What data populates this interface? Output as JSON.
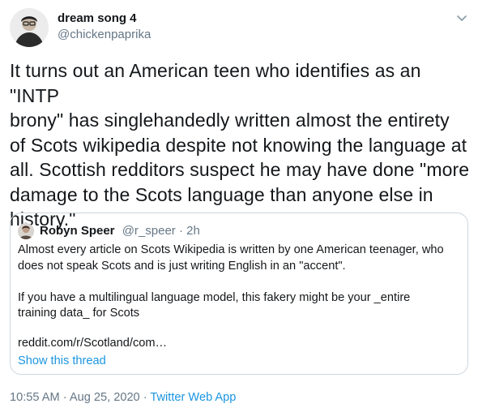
{
  "author": {
    "display_name": "dream song 4",
    "handle": "@chickenpaprika"
  },
  "tweet": {
    "text": "It turns out an American teen who identifies as an \"INTP\nbrony\" has singlehandedly written almost the entirety\nof Scots wikipedia despite not knowing the language at\nall. Scottish redditors suspect he may have done \"more\ndamage to the Scots language than anyone else in\nhistory.\""
  },
  "quoted_tweet": {
    "display_name": "Robyn Speer",
    "handle": "@r_speer",
    "separator": " · ",
    "time": "2h",
    "text": "Almost every article on Scots Wikipedia is written by one American teenager, who\ndoes not speak Scots and is just writing English in an \"accent\".\n\nIf you have a multilingual language model, this fakery might be your _entire\ntraining data_ for Scots",
    "link": "reddit.com/r/Scotland/com…",
    "show_thread": "Show this thread"
  },
  "footer": {
    "time": "10:55 AM",
    "separator": " · ",
    "date": "Aug 25, 2020",
    "source": "Twitter Web App"
  },
  "icons": {
    "more_menu": "chevron-down-icon"
  },
  "colors": {
    "text": "#14171a",
    "secondary": "#657786",
    "link": "#1b95e0",
    "border": "#ccd6dd"
  }
}
